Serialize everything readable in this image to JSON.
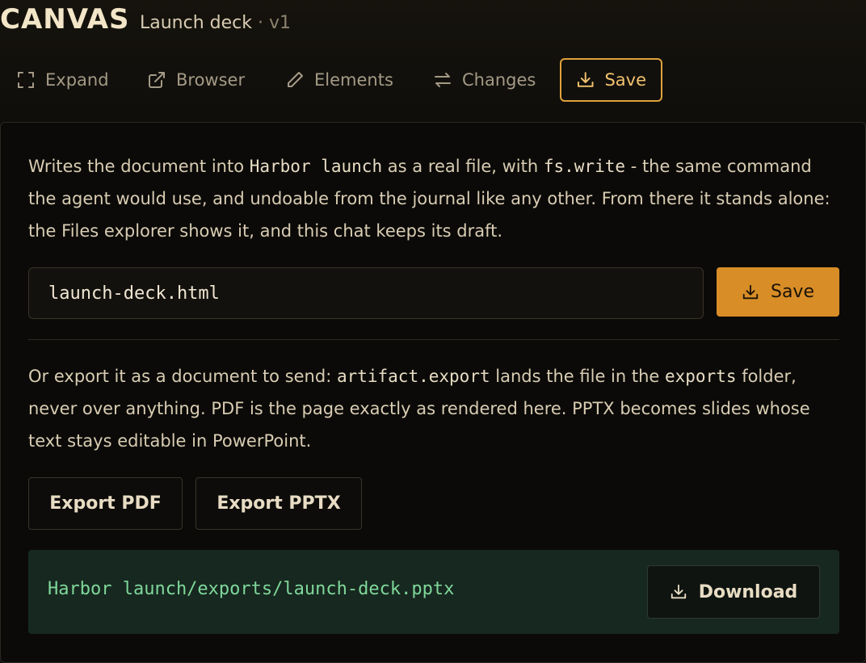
{
  "header": {
    "brand": "CANVAS",
    "doc_name": "Launch deck",
    "separator": " · ",
    "version": "v1"
  },
  "toolbar": {
    "expand": "Expand",
    "browser": "Browser",
    "elements": "Elements",
    "changes": "Changes",
    "save": "Save"
  },
  "save_section": {
    "desc_1": "Writes the document into ",
    "desc_code_1": "Harbor launch",
    "desc_2": " as a real file, with ",
    "desc_code_2": "fs.write",
    "desc_3": " - the same command the agent would use, and undoable from the journal like any other. From there it stands alone: the Files explorer shows it, and this chat keeps its draft.",
    "filename_value": "launch-deck.html",
    "save_label": "Save"
  },
  "export_section": {
    "desc_1": "Or export it as a document to send: ",
    "desc_code_1": "artifact.export",
    "desc_2": " lands the file in the ",
    "desc_code_2": "exports",
    "desc_3": " folder, never over anything. PDF is the page exactly as rendered here. PPTX becomes slides whose text stays editable in PowerPoint.",
    "export_pdf": "Export PDF",
    "export_pptx": "Export PPTX"
  },
  "result": {
    "path": "Harbor launch/exports/launch-deck.pptx",
    "download_label": "Download"
  },
  "colors": {
    "accent": "#d88d26",
    "accent_outline": "#e0a23c",
    "success_text": "#7fd89a",
    "success_bg": "#172820"
  },
  "icons": {
    "expand": "expand-icon",
    "browser": "external-link-icon",
    "elements": "pencil-icon",
    "changes": "swap-arrows-icon",
    "save": "download-icon"
  }
}
